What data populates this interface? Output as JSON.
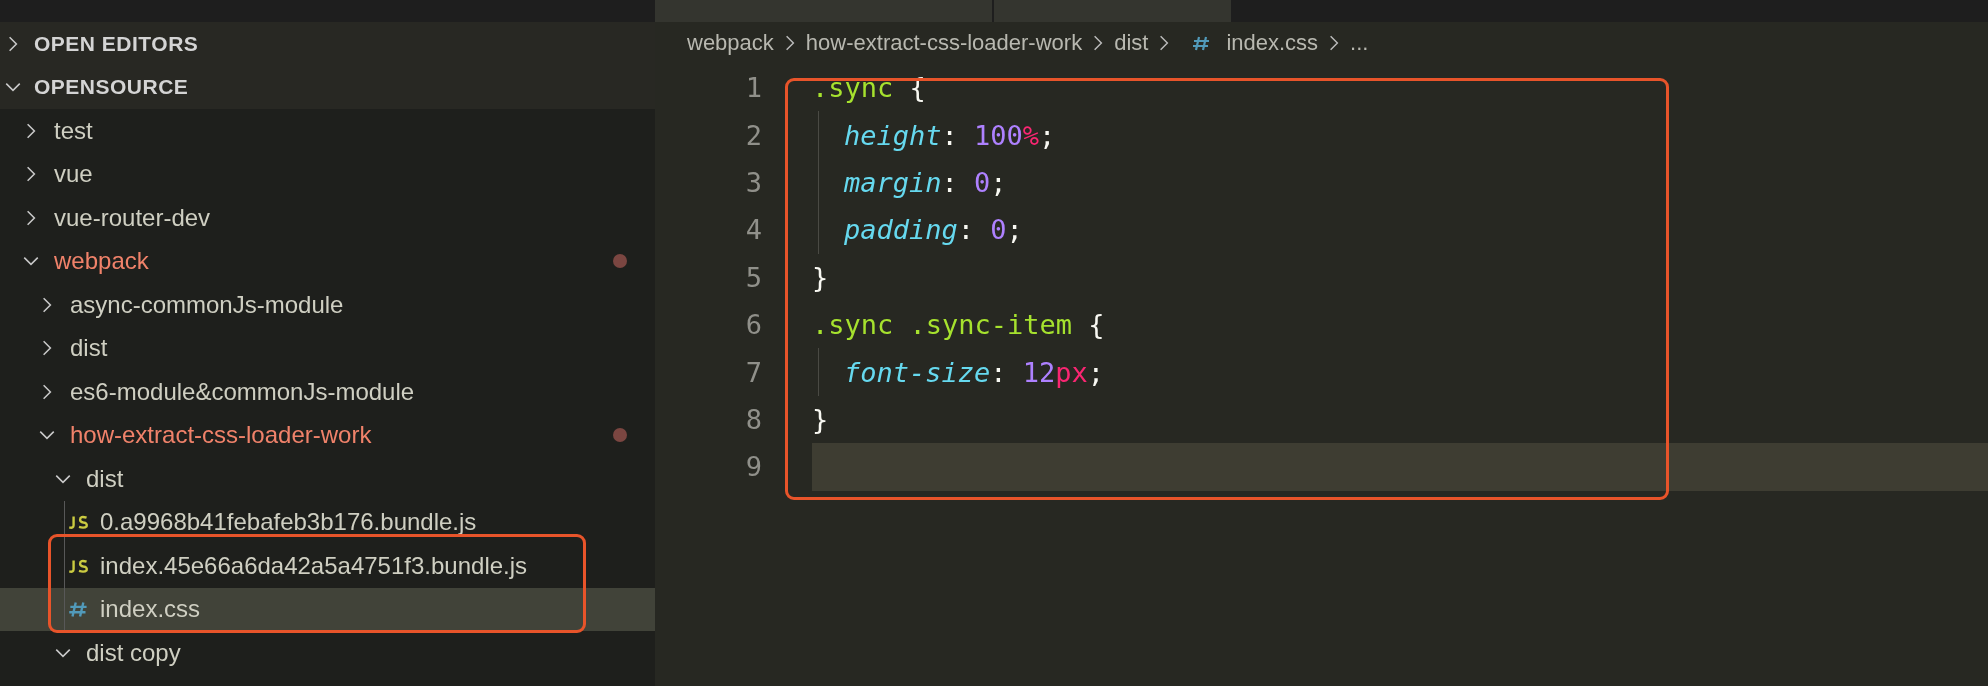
{
  "sidebar": {
    "sections": [
      {
        "label": "OPEN EDITORS",
        "expanded": false
      },
      {
        "label": "OPENSOURCE",
        "expanded": true
      }
    ],
    "tree": [
      {
        "label": "test",
        "kind": "folder",
        "expanded": false,
        "modified": false,
        "selected": false
      },
      {
        "label": "vue",
        "kind": "folder",
        "expanded": false,
        "modified": false,
        "selected": false
      },
      {
        "label": "vue-router-dev",
        "kind": "folder",
        "expanded": false,
        "modified": false,
        "selected": false
      },
      {
        "label": "webpack",
        "kind": "folder",
        "expanded": true,
        "modified": true,
        "selected": false,
        "children": [
          {
            "label": "async-commonJs-module",
            "kind": "folder",
            "expanded": false,
            "modified": false,
            "selected": false
          },
          {
            "label": "dist",
            "kind": "folder",
            "expanded": false,
            "modified": false,
            "selected": false
          },
          {
            "label": "es6-module&commonJs-module",
            "kind": "folder",
            "expanded": false,
            "modified": false,
            "selected": false
          },
          {
            "label": "how-extract-css-loader-work",
            "kind": "folder",
            "expanded": true,
            "modified": true,
            "selected": false,
            "children": [
              {
                "label": "dist",
                "kind": "folder",
                "expanded": true,
                "modified": false,
                "selected": false,
                "children": [
                  {
                    "label": "0.a9968b41febafeb3b176.bundle.js",
                    "kind": "js",
                    "modified": false,
                    "selected": false
                  },
                  {
                    "label": "index.45e66a6da42a5a4751f3.bundle.js",
                    "kind": "js",
                    "modified": false,
                    "selected": false
                  },
                  {
                    "label": "index.css",
                    "kind": "css",
                    "modified": false,
                    "selected": true
                  }
                ]
              },
              {
                "label": "dist copy",
                "kind": "folder",
                "expanded": true,
                "modified": false,
                "selected": false
              }
            ]
          }
        ]
      }
    ]
  },
  "breadcrumb": [
    {
      "label": "webpack",
      "kind": "folder"
    },
    {
      "label": "how-extract-css-loader-work",
      "kind": "folder"
    },
    {
      "label": "dist",
      "kind": "folder"
    },
    {
      "label": "index.css",
      "kind": "css"
    },
    {
      "label": "...",
      "kind": "more"
    }
  ],
  "editor": {
    "lines": [
      {
        "number": "1",
        "indent": false,
        "current": false,
        "tokens": [
          {
            "text": ".sync",
            "kind": "selector"
          },
          {
            "text": " {",
            "kind": "punct"
          }
        ]
      },
      {
        "number": "2",
        "indent": true,
        "current": false,
        "tokens": [
          {
            "text": "height",
            "kind": "property"
          },
          {
            "text": ": ",
            "kind": "punct"
          },
          {
            "text": "100",
            "kind": "number"
          },
          {
            "text": "%",
            "kind": "unit"
          },
          {
            "text": ";",
            "kind": "punct"
          }
        ]
      },
      {
        "number": "3",
        "indent": true,
        "current": false,
        "tokens": [
          {
            "text": "margin",
            "kind": "property"
          },
          {
            "text": ": ",
            "kind": "punct"
          },
          {
            "text": "0",
            "kind": "number"
          },
          {
            "text": ";",
            "kind": "punct"
          }
        ]
      },
      {
        "number": "4",
        "indent": true,
        "current": false,
        "tokens": [
          {
            "text": "padding",
            "kind": "property"
          },
          {
            "text": ": ",
            "kind": "punct"
          },
          {
            "text": "0",
            "kind": "number"
          },
          {
            "text": ";",
            "kind": "punct"
          }
        ]
      },
      {
        "number": "5",
        "indent": false,
        "current": false,
        "tokens": [
          {
            "text": "}",
            "kind": "punct"
          }
        ]
      },
      {
        "number": "6",
        "indent": false,
        "current": false,
        "tokens": [
          {
            "text": ".sync .sync-item",
            "kind": "selector"
          },
          {
            "text": " {",
            "kind": "punct"
          }
        ]
      },
      {
        "number": "7",
        "indent": true,
        "current": false,
        "tokens": [
          {
            "text": "font-size",
            "kind": "property"
          },
          {
            "text": ": ",
            "kind": "punct"
          },
          {
            "text": "12",
            "kind": "number"
          },
          {
            "text": "px",
            "kind": "unit"
          },
          {
            "text": ";",
            "kind": "punct"
          }
        ]
      },
      {
        "number": "8",
        "indent": false,
        "current": false,
        "tokens": [
          {
            "text": "}",
            "kind": "punct"
          }
        ]
      },
      {
        "number": "9",
        "indent": false,
        "current": true
      }
    ]
  }
}
